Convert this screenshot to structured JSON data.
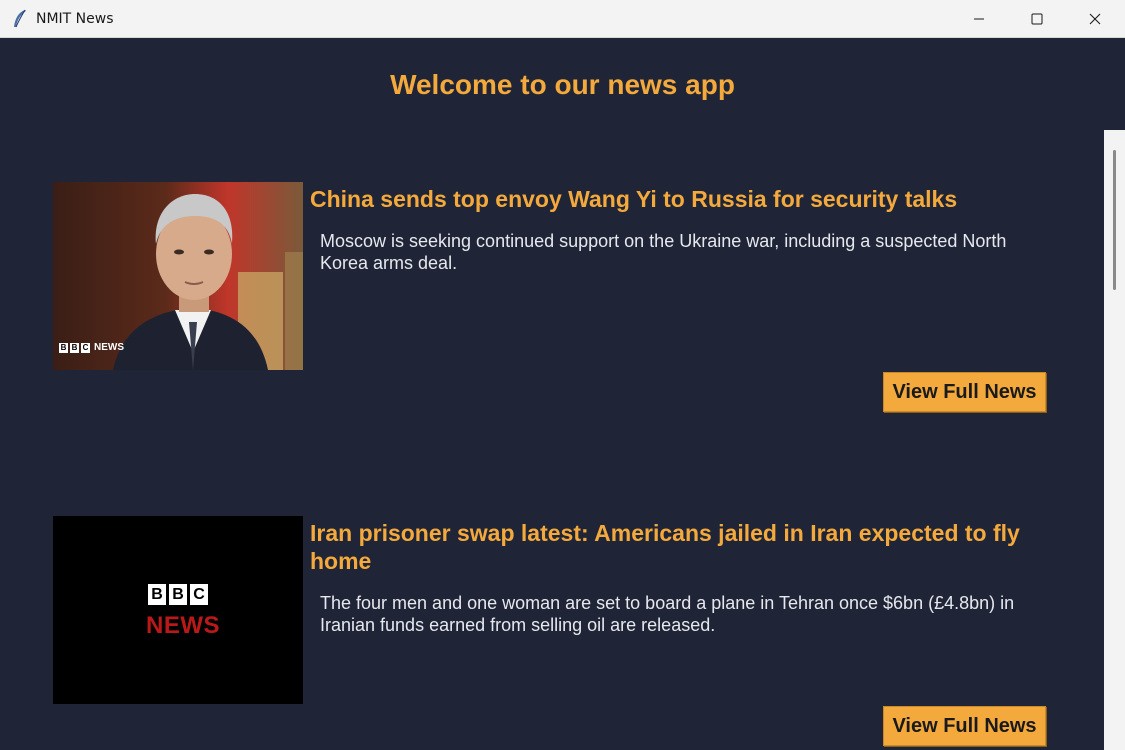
{
  "window": {
    "title": "NMIT News",
    "icon": "feather-icon",
    "controls": [
      "minimize-icon",
      "maximize-icon",
      "close-icon"
    ]
  },
  "app": {
    "heading": "Welcome to our news app"
  },
  "articles": [
    {
      "headline": "China sends top envoy Wang Yi to Russia for security talks",
      "summary": "Moscow is seeking continued support on the Ukraine war, including a suspected North Korea arms deal.",
      "image_watermark": "BBC NEWS",
      "button_label": "View Full News"
    },
    {
      "headline": "Iran prisoner swap latest: Americans jailed in Iran expected to fly home",
      "summary": "The four men and one woman are set to board a plane in Tehran once $6bn (£4.8bn) in Iranian funds earned from selling oil are released.",
      "image_logo_top": "BBC",
      "image_logo_bottom": "NEWS",
      "button_label": "View Full News"
    }
  ],
  "colors": {
    "background": "#1f2536",
    "accent": "#f4a93c",
    "text": "#e6e8ee",
    "bbc_red": "#bb1919"
  }
}
